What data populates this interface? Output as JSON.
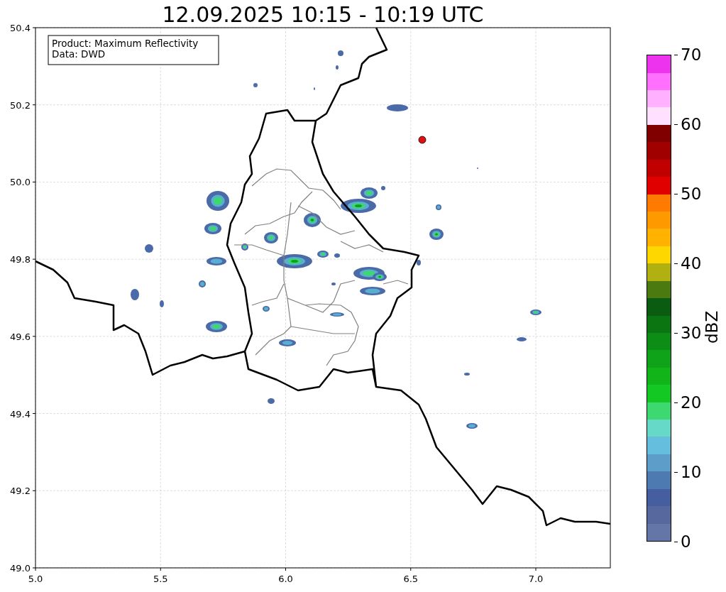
{
  "title": "12.09.2025 10:15 - 10:19 UTC",
  "map": {
    "info_box": [
      "Product: Maximum Reflectivity",
      "Data: DWD"
    ],
    "x_ticks": [
      "5.0",
      "5.5",
      "6.0",
      "6.5",
      "7.0"
    ],
    "y_ticks": [
      "50.4",
      "50.2",
      "50.0",
      "49.8",
      "49.6",
      "49.4",
      "49.2",
      "49.0"
    ]
  },
  "colorbar": {
    "label": "dBZ",
    "ticks": [
      "70",
      "60",
      "50",
      "40",
      "30",
      "20",
      "10",
      "0"
    ],
    "segments": [
      {
        "color": "#6476a8"
      },
      {
        "color": "#56689e"
      },
      {
        "color": "#445ea0"
      },
      {
        "color": "#4d7ab1"
      },
      {
        "color": "#5c9ec9"
      },
      {
        "color": "#66bedf"
      },
      {
        "color": "#66d9c9"
      },
      {
        "color": "#3ed870"
      },
      {
        "color": "#13c822"
      },
      {
        "color": "#11b519"
      },
      {
        "color": "#0fa31a"
      },
      {
        "color": "#0d8d15"
      },
      {
        "color": "#0b7512"
      },
      {
        "color": "#0a5c10"
      },
      {
        "color": "#4a7a10"
      },
      {
        "color": "#b0b010"
      },
      {
        "color": "#ffd700"
      },
      {
        "color": "#ffb300"
      },
      {
        "color": "#ff9900"
      },
      {
        "color": "#ff7a00"
      },
      {
        "color": "#e00000"
      },
      {
        "color": "#c00000"
      },
      {
        "color": "#a00000"
      },
      {
        "color": "#800000"
      },
      {
        "color": "#ffe0ff"
      },
      {
        "color": "#ffb0ff"
      },
      {
        "color": "#ff70ff"
      },
      {
        "color": "#ee33ee"
      }
    ]
  }
}
